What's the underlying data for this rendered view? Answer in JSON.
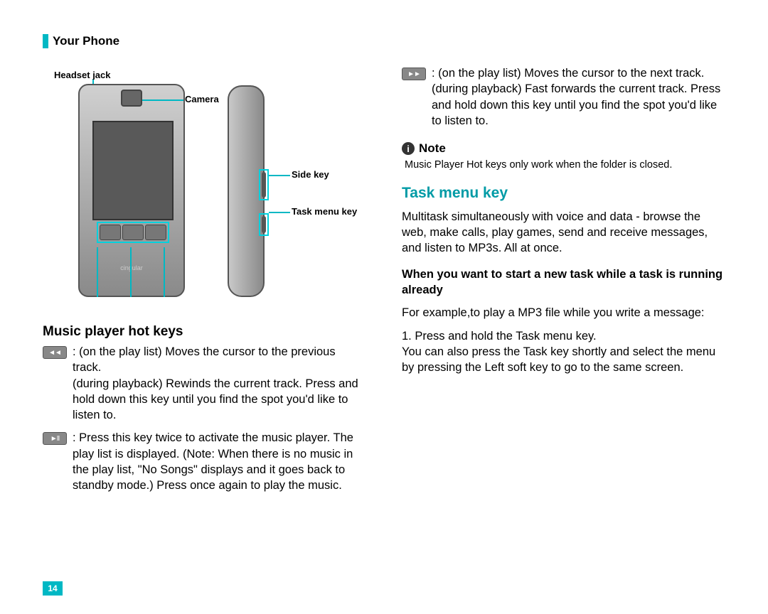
{
  "header": {
    "title": "Your Phone"
  },
  "diagram": {
    "headset": "Headset jack",
    "camera": "Camera",
    "side": "Side key",
    "task": "Task menu key",
    "brand": "cingular"
  },
  "left": {
    "section_title": "Music player hot keys",
    "rewind": ": (on the play list) Moves the cursor to the previous track.\n(during playback) Rewinds the current track. Press and hold down this key until you find the spot you'd like to listen to.",
    "play": ": Press this key twice to activate the music player. The play list is displayed. (Note: When there is no music in the play list, \"No Songs\" displays and it goes back to standby mode.) Press once again to play the music."
  },
  "right": {
    "forward": ": (on the play list) Moves the cursor to the next track.\n(during playback) Fast forwards the current track. Press and hold down this key until you find the spot you'd like to listen to.",
    "note_label": "Note",
    "note_text": "Music Player Hot keys only work when the folder is closed.",
    "task_title": "Task menu key",
    "task_intro": "Multitask simultaneously with voice and data - browse the web, make calls, play games, send and receive messages, and listen to MP3s. All at once.",
    "task_bold": "When you want to start a new task while a task is running already",
    "task_example": "For example,to play a MP3 file while you write a message:",
    "task_step": "1. Press and hold the Task menu key.\nYou can also press the Task key shortly and select the menu by pressing the Left soft key to go to the same screen."
  },
  "page": "14"
}
